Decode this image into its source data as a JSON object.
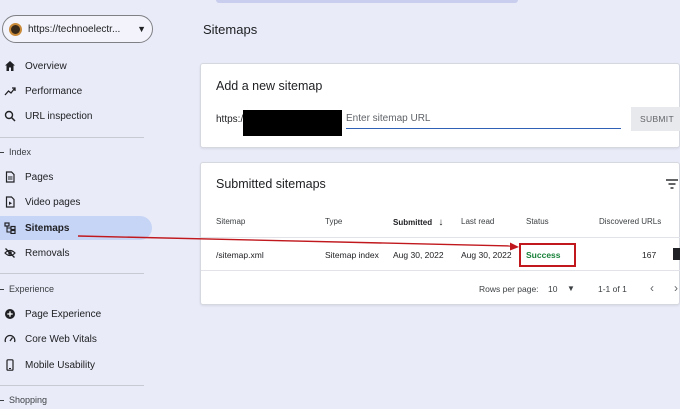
{
  "property": {
    "url": "https://technoelectr...",
    "caret": "▼"
  },
  "nav": {
    "overview": "Overview",
    "performance": "Performance",
    "url_inspection": "URL inspection",
    "section_index": "Index",
    "pages": "Pages",
    "video_pages": "Video pages",
    "sitemaps": "Sitemaps",
    "removals": "Removals",
    "section_experience": "Experience",
    "page_experience": "Page Experience",
    "core_web_vitals": "Core Web Vitals",
    "mobile_usability": "Mobile Usability",
    "section_shopping": "Shopping"
  },
  "page_title": "Sitemaps",
  "add_card": {
    "title": "Add a new sitemap",
    "prefix": "https:/",
    "input_placeholder": "Enter sitemap URL",
    "submit_label": "SUBMIT"
  },
  "list_card": {
    "title": "Submitted sitemaps",
    "headers": {
      "sitemap": "Sitemap",
      "type": "Type",
      "submitted": "Submitted",
      "sort_arrow": "↓",
      "last_read": "Last read",
      "status": "Status",
      "discovered": "Discovered URLs"
    },
    "rows": [
      {
        "sitemap": "/sitemap.xml",
        "type": "Sitemap index",
        "submitted": "Aug 30, 2022",
        "last_read": "Aug 30, 2022",
        "status": "Success",
        "discovered": "167"
      }
    ],
    "pager": {
      "rows_label": "Rows per page:",
      "rows_value": "10",
      "range": "1-1 of 1",
      "prev": "‹",
      "next": "›"
    }
  },
  "colors": {
    "background": "#e9ebf8",
    "active_nav": "#c6d4f5",
    "status_success": "#188038",
    "annotation": "#c0181d",
    "input_underline": "#2f62b7"
  }
}
